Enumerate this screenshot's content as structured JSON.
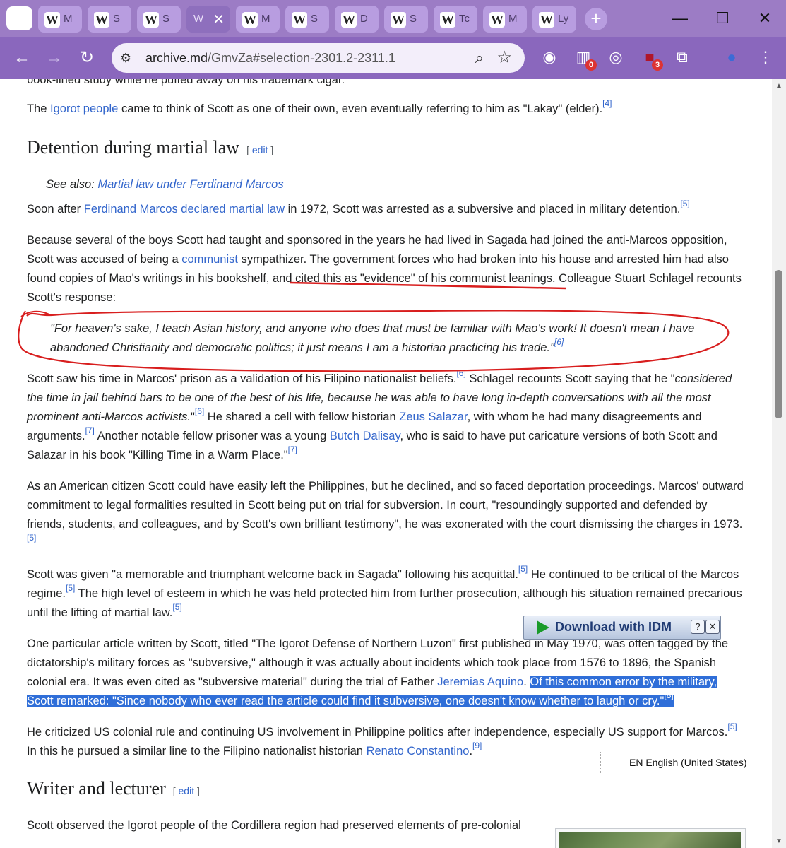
{
  "browser": {
    "tabs": [
      {
        "label": "M"
      },
      {
        "label": "S"
      },
      {
        "label": "S"
      },
      {
        "label": "W"
      },
      {
        "label": "M"
      },
      {
        "label": "S"
      },
      {
        "label": "D"
      },
      {
        "label": "S"
      },
      {
        "label": "Tc"
      },
      {
        "label": "M"
      },
      {
        "label": "Ly"
      }
    ],
    "url_host": "archive.md",
    "url_path": "/GmvZa#selection-2301.2-2311.1",
    "ext_badges": {
      "ublock": "0",
      "lastpass": "3"
    }
  },
  "article": {
    "partial_top": "book-lined study while he puffed away on his trademark cigar.",
    "p_igorot": {
      "pre": "The ",
      "link": "Igorot people",
      "post": " came to think of Scott as one of their own, even eventually referring to him as \"Lakay\" (elder).",
      "ref": "[4]"
    },
    "h_detention": "Detention during martial law",
    "edit": "edit",
    "see_also_label": "See also: ",
    "see_also_link": "Martial law under Ferdinand Marcos",
    "p_soon": {
      "pre": "Soon after ",
      "link": "Ferdinand Marcos declared martial law",
      "post": " in 1972, Scott was arrested as a subversive and placed in military detention.",
      "ref": "[5]"
    },
    "p_because": {
      "pre": "Because several of the boys Scott had taught and sponsored in the years he had lived in Sagada had joined the anti-Marcos opposition, Scott was accused of being a ",
      "link": "communist",
      "post": " sympathizer. The government forces who had broken into his house and arrested him had also found copies of Mao's writings in his bookshelf, and cited this as \"evidence\" of his communist leanings. Colleague Stuart Schlagel recounts Scott's response:"
    },
    "quote": {
      "text": "\"For heaven's sake, I teach Asian history, and anyone who does that must be familiar with Mao's work! It doesn't mean I have abandoned Christianity and democratic politics; it just means I am a historian practicing his trade.\"",
      "ref": "[6]"
    },
    "p_prison": {
      "a": "Scott saw his time in Marcos' prison as a validation of his Filipino nationalist beliefs.",
      "ref1": "[6]",
      "b": " Schlagel recounts Scott saying that he \"",
      "italic": "considered the time in jail behind bars to be one of the best of his life, because he was able to have long in-depth conversations with all the most prominent anti-Marcos activists.",
      "c": "\"",
      "ref2": "[6]",
      "d": " He shared a cell with fellow historian ",
      "link1": "Zeus Salazar",
      "e": ", with whom he had many disagreements and arguments.",
      "ref3": "[7]",
      "f": " Another notable fellow prisoner was a young ",
      "link2": "Butch Dalisay",
      "g": ", who is said to have put caricature versions of both Scott and Salazar in his book \"Killing Time in a Warm Place.\"",
      "ref4": "[7]"
    },
    "p_american": {
      "text": "As an American citizen Scott could have easily left the Philippines, but he declined, and so faced deportation proceedings. Marcos' outward commitment to legal formalities resulted in Scott being put on trial for subversion. In court, \"resoundingly supported and defended by friends, students, and colleagues, and by Scott's own brilliant testimony\", he was exonerated with the court dismissing the charges in 1973.",
      "ref": "[5]"
    },
    "p_welcome": {
      "a": "Scott was given \"a memorable and triumphant welcome back in Sagada\" following his acquittal.",
      "ref1": "[5]",
      "b": " He continued to be critical of the Marcos regime.",
      "ref2": "[5]",
      "c": " The high level of esteem in which he was held protected him from further prosecution, although his situation remained precarious until the lifting of martial law.",
      "ref3": "[5]"
    },
    "p_article": {
      "a": "One particular article written by Scott, titled \"The Igorot Defense of Northern Luzon\" first published in May 1970, was often tagged by the dictatorship's military forces as \"subversive,\" although it was actually about incidents which took place from 1576 to 1896, the Spanish colonial era. It was even cited as \"subversive material\" during the trial of Father ",
      "link": "Jeremias Aquino",
      "b": ". ",
      "selected": "Of this common error by the military, Scott remarked: \"Since nobody who ever read the article could find it subversive, one doesn't know whether to laugh or cry.\"",
      "ref": "[8]"
    },
    "p_criticized": {
      "a": "He criticized US colonial rule and continuing US involvement in Philippine politics after independence, especially US support for Marcos.",
      "ref1": "[5]",
      "b": " In this he pursued a similar line to the Filipino nationalist historian ",
      "link": "Renato Constantino",
      "c": ".",
      "ref2": "[9]"
    },
    "h_writer": "Writer and lecturer",
    "p_observed": "Scott observed the Igorot people of the Cordillera region had preserved elements of pre-colonial"
  },
  "idm": {
    "label": "Download with IDM",
    "help": "?",
    "close": "✕"
  },
  "language_bar": {
    "label": "EN English (United States)"
  },
  "colors": {
    "tabstrip": "#9c7cc5",
    "toolbar": "#8a67bd",
    "link": "#3366cc",
    "selection": "#2f6ed8",
    "annotation": "#d81e1e"
  }
}
